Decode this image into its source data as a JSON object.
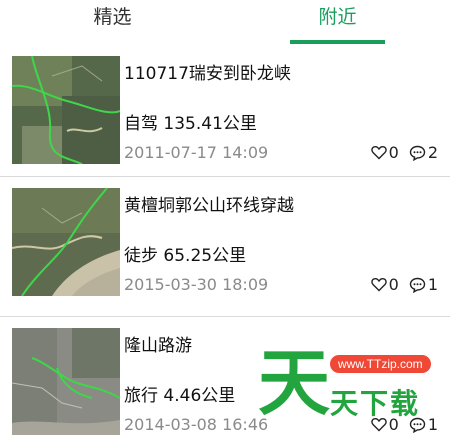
{
  "tabs": [
    {
      "label": "精选",
      "active": false
    },
    {
      "label": "附近",
      "active": true
    }
  ],
  "accent_color": "#1a9e5c",
  "items": [
    {
      "title": "110717瑞安到卧龙峡",
      "mode_distance": "自驾 135.41公里",
      "time": "2011-07-17 14:09",
      "likes": "0",
      "comments": "2"
    },
    {
      "title": "黄檀垌郭公山环线穿越",
      "mode_distance": "徒步 65.25公里",
      "time": "2015-03-30 18:09",
      "likes": "0",
      "comments": "1"
    },
    {
      "title": "隆山路游",
      "mode_distance": "旅行 4.46公里",
      "time": "2014-03-08 16:46",
      "likes": "0",
      "comments": "1"
    }
  ],
  "icons": {
    "like": "heart-icon",
    "comment": "comment-bubble-icon"
  },
  "watermark": {
    "big_char": "天",
    "url": "www.TTzip.com",
    "text": "天下载"
  }
}
